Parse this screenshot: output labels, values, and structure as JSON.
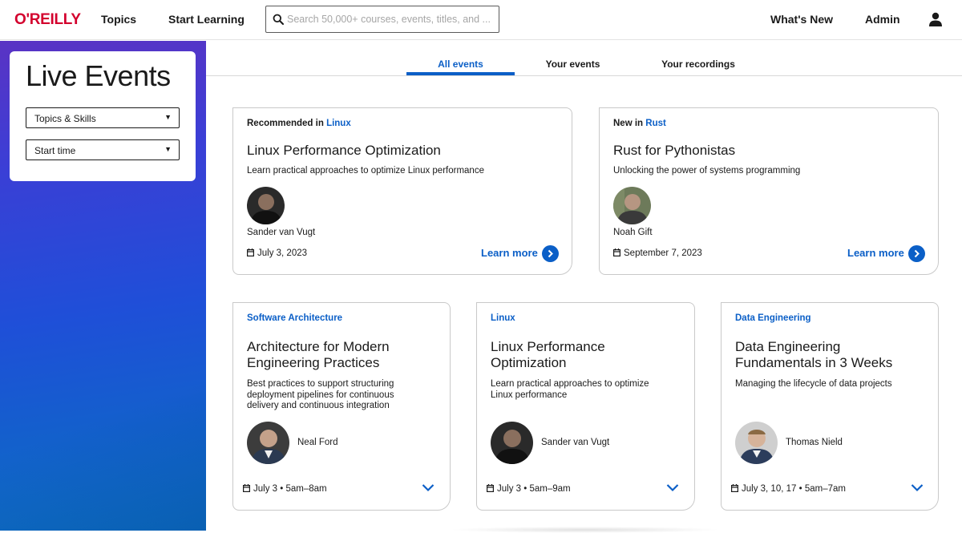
{
  "nav": {
    "logo": "O'REILLY",
    "topics": "Topics",
    "start_learning": "Start Learning",
    "search_placeholder": "Search 50,000+ courses, events, titles, and ...",
    "whats_new": "What's New",
    "admin": "Admin",
    "user_icon": "user-icon"
  },
  "sidebar": {
    "title": "Live Events",
    "filters": [
      {
        "label": "Topics & Skills"
      },
      {
        "label": "Start time"
      }
    ]
  },
  "tabs": [
    {
      "label": "All events",
      "active": true
    },
    {
      "label": "Your events",
      "active": false
    },
    {
      "label": "Your recordings",
      "active": false
    }
  ],
  "featured": [
    {
      "prefix": "Recommended in ",
      "topic": "Linux",
      "title": "Linux Performance Optimization",
      "description": "Learn practical approaches to optimize Linux performance",
      "instructor": "Sander van Vugt",
      "date": "July 3, 2023",
      "cta": "Learn more"
    },
    {
      "prefix": "New in ",
      "topic": "Rust",
      "title": "Rust for Pythonistas",
      "description": "Unlocking the power of systems programming",
      "instructor": "Noah Gift",
      "date": "September 7, 2023",
      "cta": "Learn more"
    }
  ],
  "events": [
    {
      "topic": "Software Architecture",
      "title_lines": [
        "Architecture for Modern",
        "Engineering Practices"
      ],
      "description_lines": [
        "Best practices to support structuring",
        "deployment pipelines for continuous",
        "delivery and continuous integration"
      ],
      "instructor": "Neal Ford",
      "date": "July 3 • 5am–8am"
    },
    {
      "topic": "Linux",
      "title_lines": [
        "Linux Performance",
        "Optimization"
      ],
      "description_lines": [
        "Learn practical approaches to optimize",
        "Linux performance"
      ],
      "instructor": "Sander van Vugt",
      "date": "July 3 • 5am–9am"
    },
    {
      "topic": "Data Engineering",
      "title_lines": [
        "Data Engineering",
        "Fundamentals in 3 Weeks"
      ],
      "description_lines": [
        "Managing the lifecycle of data projects"
      ],
      "instructor": "Thomas Nield",
      "date": "July 3, 10, 17 • 5am–7am"
    }
  ],
  "colors": {
    "brand": "#d3002d",
    "accent": "#0b5fc7"
  }
}
